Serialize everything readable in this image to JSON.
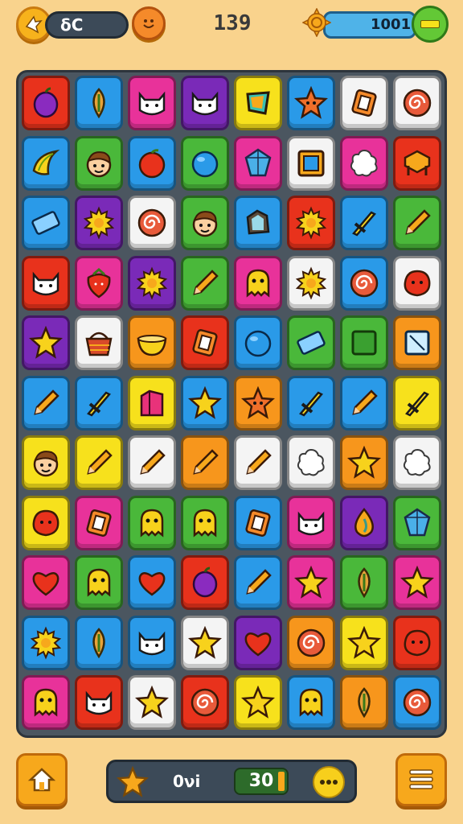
{
  "header": {
    "left_value": "δC",
    "score": "139",
    "coins": "1001"
  },
  "footer": {
    "label": "0νi",
    "counter": "30"
  },
  "colors": {
    "background": "#f9d38d",
    "board": "#4b5660"
  },
  "board": {
    "columns": 8,
    "rows": 11,
    "tiles": [
      [
        "red",
        "plum"
      ],
      [
        "blue",
        "leaf"
      ],
      [
        "magenta",
        "cat-face"
      ],
      [
        "purple",
        "cat-face"
      ],
      [
        "yellow",
        "gem"
      ],
      [
        "blue",
        "star-face"
      ],
      [
        "white",
        "rect"
      ],
      [
        "white",
        "swirl"
      ],
      [
        "blue",
        "banana"
      ],
      [
        "green",
        "face"
      ],
      [
        "blue",
        "apple"
      ],
      [
        "green",
        "ball"
      ],
      [
        "magenta",
        "crystal"
      ],
      [
        "white",
        "frame"
      ],
      [
        "magenta",
        "splat"
      ],
      [
        "red",
        "chest"
      ],
      [
        "blue",
        "eraser"
      ],
      [
        "purple",
        "sun"
      ],
      [
        "white",
        "swirl"
      ],
      [
        "green",
        "face"
      ],
      [
        "blue",
        "stone"
      ],
      [
        "red",
        "sun"
      ],
      [
        "blue",
        "sword"
      ],
      [
        "green",
        "pencil"
      ],
      [
        "red",
        "cat-face"
      ],
      [
        "magenta",
        "strawberry"
      ],
      [
        "purple",
        "sun"
      ],
      [
        "green",
        "pencil"
      ],
      [
        "magenta",
        "ghost"
      ],
      [
        "white",
        "sun"
      ],
      [
        "blue",
        "swirl"
      ],
      [
        "white",
        "blob"
      ],
      [
        "purple",
        "star"
      ],
      [
        "white",
        "basket"
      ],
      [
        "orange",
        "bowl"
      ],
      [
        "red",
        "rect"
      ],
      [
        "blue",
        "ball"
      ],
      [
        "green",
        "eraser"
      ],
      [
        "green",
        "square"
      ],
      [
        "orange",
        "glass"
      ],
      [
        "blue",
        "pencil"
      ],
      [
        "blue",
        "sword"
      ],
      [
        "yellow",
        "box"
      ],
      [
        "blue",
        "star"
      ],
      [
        "orange",
        "star-face"
      ],
      [
        "blue",
        "sword"
      ],
      [
        "blue",
        "pencil"
      ],
      [
        "yellow",
        "sword"
      ],
      [
        "yellow",
        "face"
      ],
      [
        "yellow",
        "pencil"
      ],
      [
        "white",
        "pencil"
      ],
      [
        "orange",
        "pencil"
      ],
      [
        "white",
        "pencil"
      ],
      [
        "white",
        "splat"
      ],
      [
        "orange",
        "star"
      ],
      [
        "white",
        "splat"
      ],
      [
        "yellow",
        "blob"
      ],
      [
        "magenta",
        "rect"
      ],
      [
        "green",
        "ghost"
      ],
      [
        "green",
        "ghost"
      ],
      [
        "blue",
        "rect"
      ],
      [
        "magenta",
        "cat-face"
      ],
      [
        "purple",
        "drop"
      ],
      [
        "green",
        "crystal"
      ],
      [
        "magenta",
        "heart"
      ],
      [
        "green",
        "ghost"
      ],
      [
        "blue",
        "heart"
      ],
      [
        "red",
        "plum"
      ],
      [
        "blue",
        "pencil"
      ],
      [
        "magenta",
        "star"
      ],
      [
        "green",
        "leaf"
      ],
      [
        "magenta",
        "star"
      ],
      [
        "blue",
        "sun"
      ],
      [
        "blue",
        "leaf"
      ],
      [
        "blue",
        "cat-face"
      ],
      [
        "white",
        "star"
      ],
      [
        "purple",
        "heart"
      ],
      [
        "orange",
        "swirl"
      ],
      [
        "yellow",
        "star"
      ],
      [
        "red",
        "blob"
      ],
      [
        "magenta",
        "ghost"
      ],
      [
        "red",
        "cat-face"
      ],
      [
        "white",
        "star"
      ],
      [
        "red",
        "swirl"
      ],
      [
        "yellow",
        "star"
      ],
      [
        "blue",
        "ghost"
      ],
      [
        "orange",
        "leaf"
      ],
      [
        "blue",
        "swirl"
      ]
    ]
  }
}
